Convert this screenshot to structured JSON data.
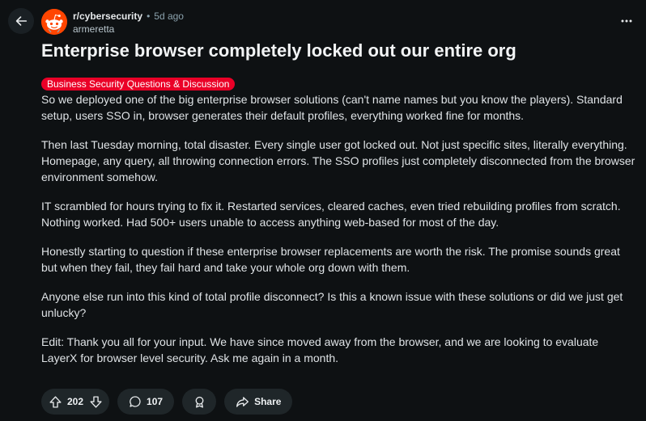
{
  "post": {
    "subreddit": "r/cybersecurity",
    "separator": "•",
    "age": "5d ago",
    "author": "armeretta",
    "title": "Enterprise browser completely locked out our entire org",
    "flair": "Business Security Questions & Discussion",
    "paragraphs": [
      "So we deployed one of the big enterprise browser solutions (can't name names but you know the players). Standard setup, users SSO in, browser generates their default profiles, everything worked fine for months.",
      "Then last Tuesday morning, total disaster. Every single user got locked out. Not just specific sites, literally everything. Homepage, any query, all throwing connection errors. The SSO profiles just completely disconnected from the browser environment somehow.",
      "IT scrambled for hours trying to fix it. Restarted services, cleared caches, even tried rebuilding profiles from scratch. Nothing worked. Had 500+ users unable to access anything web-based for most of the day.",
      "Honestly starting to question if these enterprise browser replacements are worth the risk. The promise sounds great but when they fail, they fail hard and take your whole org down with them.",
      "Anyone else run into this kind of total profile disconnect? Is this a known issue with these solutions or did we just get unlucky?",
      "Edit: Thank you all for your input. We have since moved away from the browser, and we are looking to evaluate LayerX for browser level security. Ask me again in a month."
    ]
  },
  "actions": {
    "votes": "202",
    "comments": "107",
    "share_label": "Share"
  },
  "icons": {
    "back": "back-arrow-icon",
    "more": "more-options-icon",
    "upvote": "upvote-icon",
    "downvote": "downvote-icon",
    "comment": "comment-icon",
    "award": "award-icon",
    "share": "share-icon",
    "avatar": "reddit-snoo-icon"
  },
  "colors": {
    "background": "#0e1113",
    "flair": "#ea0027",
    "avatar": "#ff4500",
    "pill": "#1f2629"
  }
}
